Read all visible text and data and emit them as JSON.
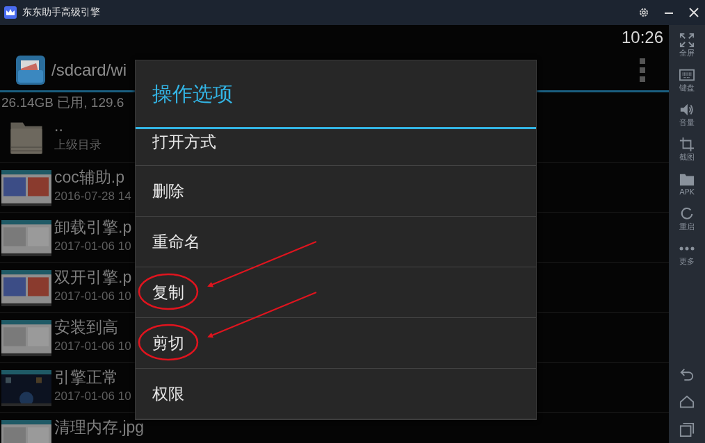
{
  "window": {
    "title": "东东助手高级引擎"
  },
  "status_bar": {
    "time": "10:26"
  },
  "action_bar": {
    "path": "/sdcard/wi"
  },
  "storage": "26.14GB 已用, 129.6",
  "files": [
    {
      "kind": "folder",
      "name": "..",
      "detail": "上级目录"
    },
    {
      "name": "coc辅助.p",
      "detail": "2016-07-28 14"
    },
    {
      "name": "卸载引擎.p",
      "detail": "2017-01-06 10"
    },
    {
      "name": "双开引擎.p",
      "detail": "2017-01-06 10"
    },
    {
      "name": "安装到高",
      "detail": "2017-01-06 10"
    },
    {
      "name": "引擎正常",
      "detail": "2017-01-06 10"
    },
    {
      "name": "清理内存.jpg"
    }
  ],
  "dialog": {
    "title": "操作选项",
    "options": [
      {
        "label": "打开方式",
        "circled": false
      },
      {
        "label": "删除",
        "circled": false
      },
      {
        "label": "重命名",
        "circled": false
      },
      {
        "label": "复制",
        "circled": true
      },
      {
        "label": "剪切",
        "circled": true
      },
      {
        "label": "权限",
        "circled": false
      }
    ]
  },
  "sidebar": {
    "items": [
      {
        "kind": "fullscreen",
        "label": "全屏"
      },
      {
        "kind": "keyboard",
        "label": "键盘"
      },
      {
        "kind": "volume",
        "label": "音量"
      },
      {
        "kind": "crop",
        "label": "截图"
      },
      {
        "kind": "folder",
        "label": "APK"
      },
      {
        "kind": "restart",
        "label": "重启"
      },
      {
        "kind": "more",
        "label": "更多"
      }
    ]
  },
  "nav": [
    {
      "kind": "back"
    },
    {
      "kind": "home"
    },
    {
      "kind": "recents"
    }
  ]
}
